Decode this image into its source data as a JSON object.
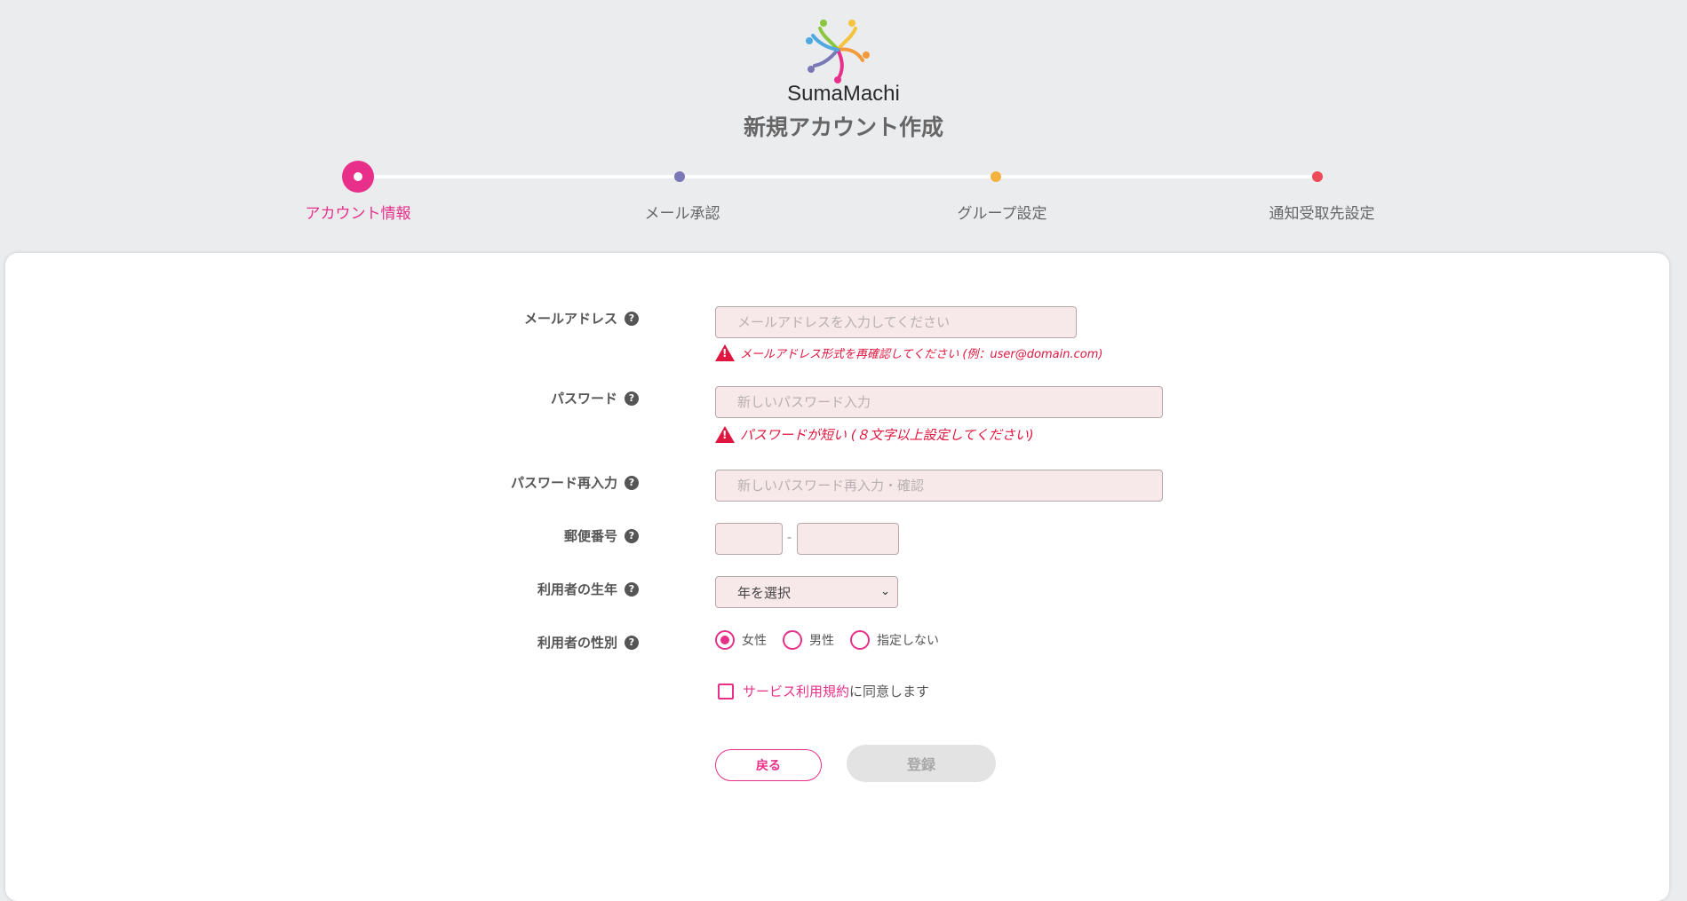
{
  "app": {
    "name": "SumaMachi",
    "page_title": "新規アカウント作成"
  },
  "steps": [
    {
      "label": "アカウント情報",
      "color": "#e8308a",
      "active": true
    },
    {
      "label": "メール承認",
      "color": "#7b78b8"
    },
    {
      "label": "グループ設定",
      "color": "#f5b13d"
    },
    {
      "label": "通知受取先設定",
      "color": "#ee4a5a"
    }
  ],
  "form": {
    "email": {
      "label": "メールアドレス",
      "placeholder": "メールアドレスを入力してください",
      "error": "メールアドレス形式を再確認してください (例：user@domain.com)"
    },
    "password": {
      "label": "パスワード",
      "placeholder": "新しいパスワード入力",
      "error": "パスワードが短い (８文字以上設定してください)"
    },
    "password_confirm": {
      "label": "パスワード再入力",
      "placeholder": "新しいパスワード再入力・確認"
    },
    "postal": {
      "label": "郵便番号",
      "separator": "-"
    },
    "birth_year": {
      "label": "利用者の生年",
      "selected": "年を選択"
    },
    "gender": {
      "label": "利用者の性別",
      "options": [
        "女性",
        "男性",
        "指定しない"
      ],
      "selected": "女性"
    },
    "agreement": {
      "link_text": "サービス利用規約",
      "suffix": "に同意します"
    },
    "buttons": {
      "back": "戻る",
      "register": "登録"
    }
  }
}
